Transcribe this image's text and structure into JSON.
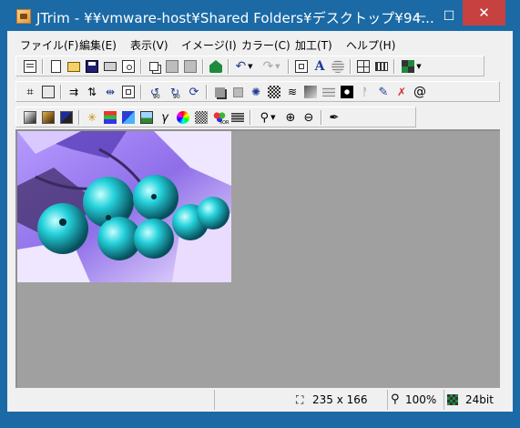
{
  "window": {
    "title": "JTrim - ¥¥vmware-host¥Shared Folders¥デスクトップ¥94...",
    "minimize_glyph": "—",
    "maximize_glyph": "☐",
    "close_glyph": "✕"
  },
  "menu": [
    {
      "label": "ファイル(F)"
    },
    {
      "label": "編集(E)"
    },
    {
      "label": "表示(V)"
    },
    {
      "label": "イメージ(I)"
    },
    {
      "label": "カラー(C)"
    },
    {
      "label": "加工(T)"
    },
    {
      "label": "ヘルプ(H)"
    }
  ],
  "toolbar": {
    "rotate_ccw_label": "90",
    "rotate_cw_label": "90",
    "text_icon_label": "A",
    "xor_label": "XOR"
  },
  "status": {
    "size": "235 x 166",
    "zoom": "100%",
    "depth": "24bit"
  },
  "colors": {
    "titlebar": "#1b6aa6",
    "close_button": "#c74141",
    "canvas_bg": "#a0a0a0"
  }
}
